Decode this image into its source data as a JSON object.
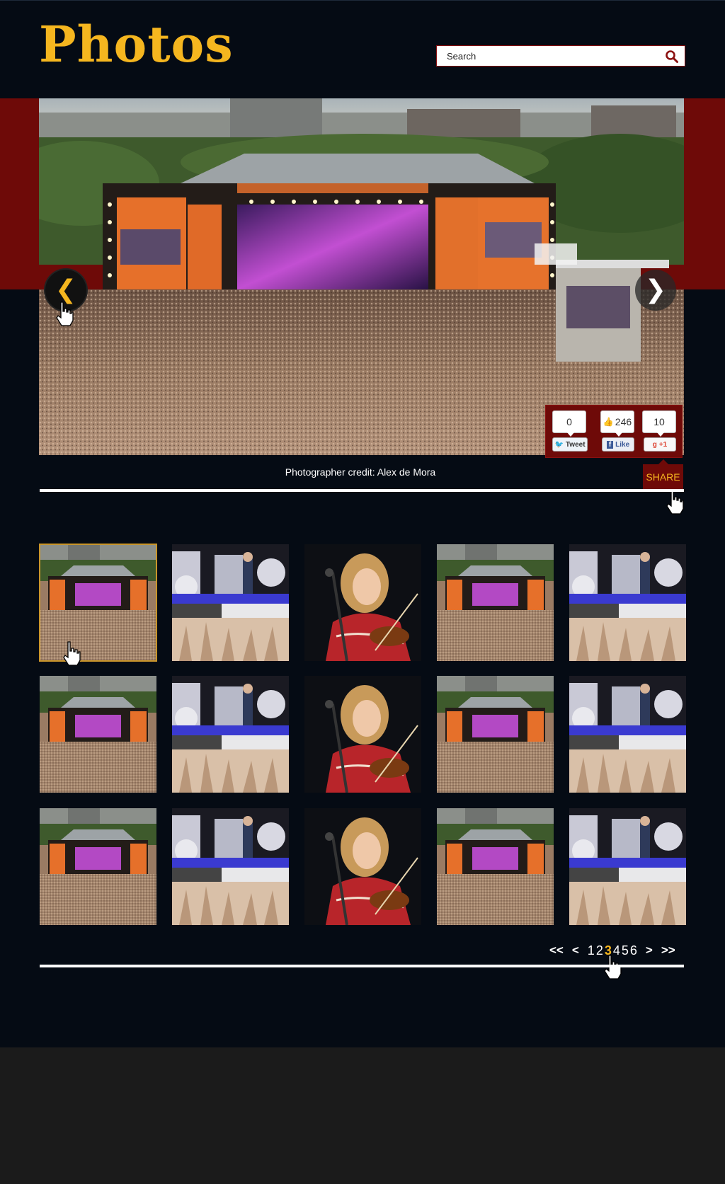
{
  "header": {
    "title": "Photos",
    "search_placeholder": "Search"
  },
  "hero": {
    "credit": "Photographer credit: Alex de Mora",
    "prev_label": "❮",
    "next_label": "❯"
  },
  "share": {
    "tweet_count": "0",
    "like_count": "246",
    "plus_count": "10",
    "tweet_label": "Tweet",
    "like_label": "Like",
    "plus_label": "+1",
    "tab_label": "SHARE"
  },
  "pagination": {
    "first": "<<",
    "prev": "<",
    "pages": [
      "1",
      "2",
      "3",
      "4",
      "5",
      "6"
    ],
    "current": "3",
    "next": ">",
    "last": ">>"
  },
  "thumbnails": [
    {
      "kind": "festival-stage",
      "active": true
    },
    {
      "kind": "band-on-stage"
    },
    {
      "kind": "violinist"
    },
    {
      "kind": "festival-stage"
    },
    {
      "kind": "band-on-stage"
    },
    {
      "kind": "festival-stage"
    },
    {
      "kind": "band-on-stage"
    },
    {
      "kind": "violinist"
    },
    {
      "kind": "festival-stage"
    },
    {
      "kind": "band-on-stage"
    },
    {
      "kind": "festival-stage"
    },
    {
      "kind": "band-on-stage"
    },
    {
      "kind": "violinist"
    },
    {
      "kind": "festival-stage"
    },
    {
      "kind": "band-on-stage"
    }
  ],
  "colors": {
    "accent": "#f5b61f",
    "brand_red": "#6e0a08",
    "background": "#050b14"
  }
}
